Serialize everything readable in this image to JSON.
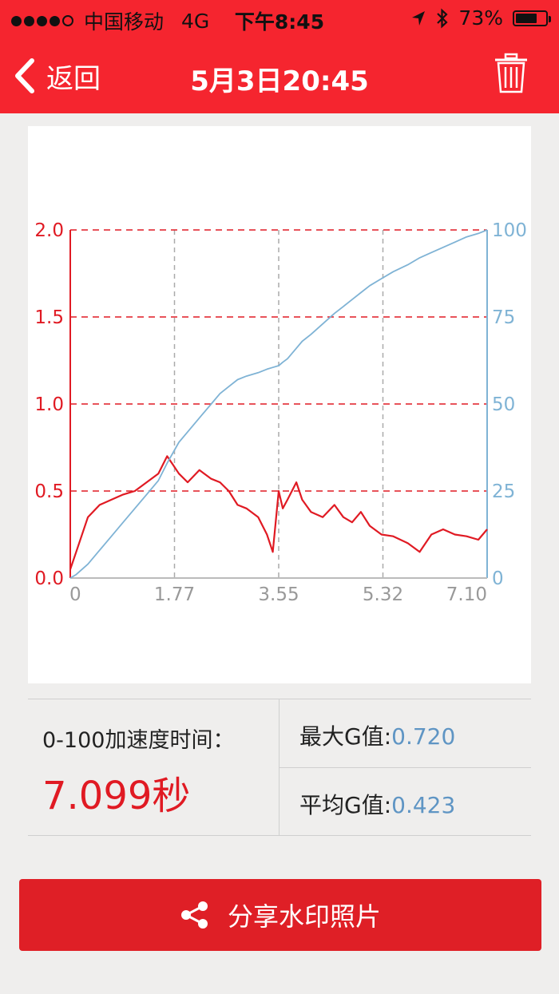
{
  "status_bar": {
    "carrier": "中国移动",
    "network": "4G",
    "time": "下午8:45",
    "battery": "73%",
    "battery_level": 0.73
  },
  "header": {
    "back_label": "返回",
    "title": "5月3日20:45",
    "icons": {
      "back": "chevron-left-icon",
      "delete": "trash-icon"
    }
  },
  "colors": {
    "brand": "#f5252f",
    "g_series": "#e01a23",
    "speed_series": "#7fb3d5",
    "value_blue": "#5f95c4"
  },
  "chart_data": {
    "type": "line",
    "x": [
      0,
      0.1,
      0.3,
      0.5,
      0.7,
      0.9,
      1.1,
      1.3,
      1.5,
      1.65,
      1.75,
      1.85,
      2.0,
      2.2,
      2.4,
      2.55,
      2.7,
      2.85,
      3.0,
      3.2,
      3.35,
      3.45,
      3.55,
      3.62,
      3.7,
      3.85,
      3.95,
      4.1,
      4.3,
      4.5,
      4.65,
      4.8,
      4.95,
      5.1,
      5.3,
      5.5,
      5.75,
      5.95,
      6.15,
      6.35,
      6.55,
      6.75,
      6.95,
      7.1
    ],
    "x_ticks": [
      "0",
      "1.77",
      "3.55",
      "5.32",
      "7.10"
    ],
    "xlim": [
      0,
      7.1
    ],
    "series": [
      {
        "axis": "left",
        "color": "#e01a23",
        "values": [
          0.05,
          0.15,
          0.35,
          0.42,
          0.45,
          0.48,
          0.5,
          0.55,
          0.6,
          0.7,
          0.65,
          0.6,
          0.55,
          0.62,
          0.57,
          0.55,
          0.5,
          0.42,
          0.4,
          0.35,
          0.25,
          0.15,
          0.5,
          0.4,
          0.45,
          0.55,
          0.45,
          0.38,
          0.35,
          0.42,
          0.35,
          0.32,
          0.38,
          0.3,
          0.25,
          0.24,
          0.2,
          0.15,
          0.25,
          0.28,
          0.25,
          0.24,
          0.22,
          0.28
        ]
      },
      {
        "axis": "right",
        "color": "#7fb3d5",
        "values": [
          0,
          1,
          4,
          8,
          12,
          16,
          20,
          24,
          28,
          33,
          36,
          39,
          42,
          46,
          50,
          53,
          55,
          57,
          58,
          59,
          60,
          60.5,
          61,
          62,
          63,
          66,
          68,
          70,
          73,
          76,
          78,
          80,
          82,
          84,
          86,
          88,
          90,
          92,
          93.5,
          95,
          96.5,
          98,
          99,
          100
        ]
      }
    ],
    "y_left": {
      "ticks": [
        "0.0",
        "0.5",
        "1.0",
        "1.5",
        "2.0"
      ],
      "ylim": [
        0,
        2.0
      ]
    },
    "y_right": {
      "ticks": [
        "0",
        "25",
        "50",
        "75",
        "100"
      ],
      "ylim": [
        0,
        100
      ]
    },
    "grid": true,
    "legend": "none"
  },
  "stats": {
    "accel_label": "0-100加速度时间：",
    "accel_value": "7.099秒",
    "max_g_label": "最大G值:",
    "max_g_value": "0.720",
    "avg_g_label": "平均G值:",
    "avg_g_value": "0.423"
  },
  "share": {
    "label": "分享水印照片",
    "icon": "share-icon"
  }
}
